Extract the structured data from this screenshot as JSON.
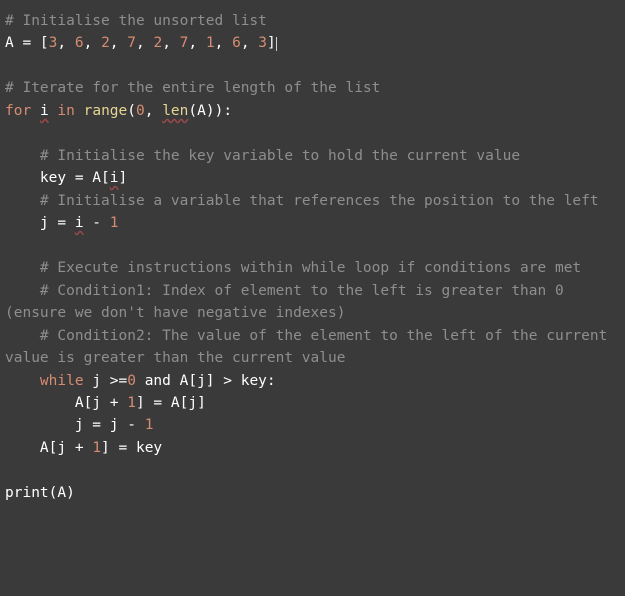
{
  "code": {
    "l01": "# Initialise the unsorted list",
    "l02a": "A",
    "l02b": " = [",
    "nums": [
      "3",
      "6",
      "2",
      "7",
      "2",
      "7",
      "1",
      "6",
      "3"
    ],
    "l02c": "]",
    "l03": "",
    "l04": "# Iterate for the entire length of the list",
    "l05_for": "for",
    "l05_i": "i",
    "l05_in": "in",
    "l05_range": "range",
    "l05_open": "(",
    "l05_zero": "0",
    "l05_comma": ", ",
    "l05_len": "len",
    "l05_lenopen": "(A)):",
    "l07": "    # Initialise the key variable to hold the current value",
    "l08a": "    key = A[",
    "l08b": "i",
    "l08c": "]",
    "l09": "    # Initialise a variable that references the position to the left",
    "l10a": "    j = ",
    "l10b": "i",
    "l10c": " - ",
    "l10d": "1",
    "l12": "    # Execute instructions within while loop if conditions are met",
    "l13": "    # Condition1: Index of element to the left is greater than 0 (ensure we don't have negative indexes)",
    "l14": "    # Condition2: The value of the element to the left of the current value is greater than the current value",
    "l15_while": "    while",
    "l15_body1": " j >=",
    "l15_zero": "0",
    "l15_body2": " and A[j] > key:",
    "l16a": "        A[j + ",
    "l16b": "1",
    "l16c": "] = A[j]",
    "l17a": "        j = j - ",
    "l17b": "1",
    "l18a": "    A[j + ",
    "l18b": "1",
    "l18c": "] = key",
    "l20": "print(A)"
  }
}
